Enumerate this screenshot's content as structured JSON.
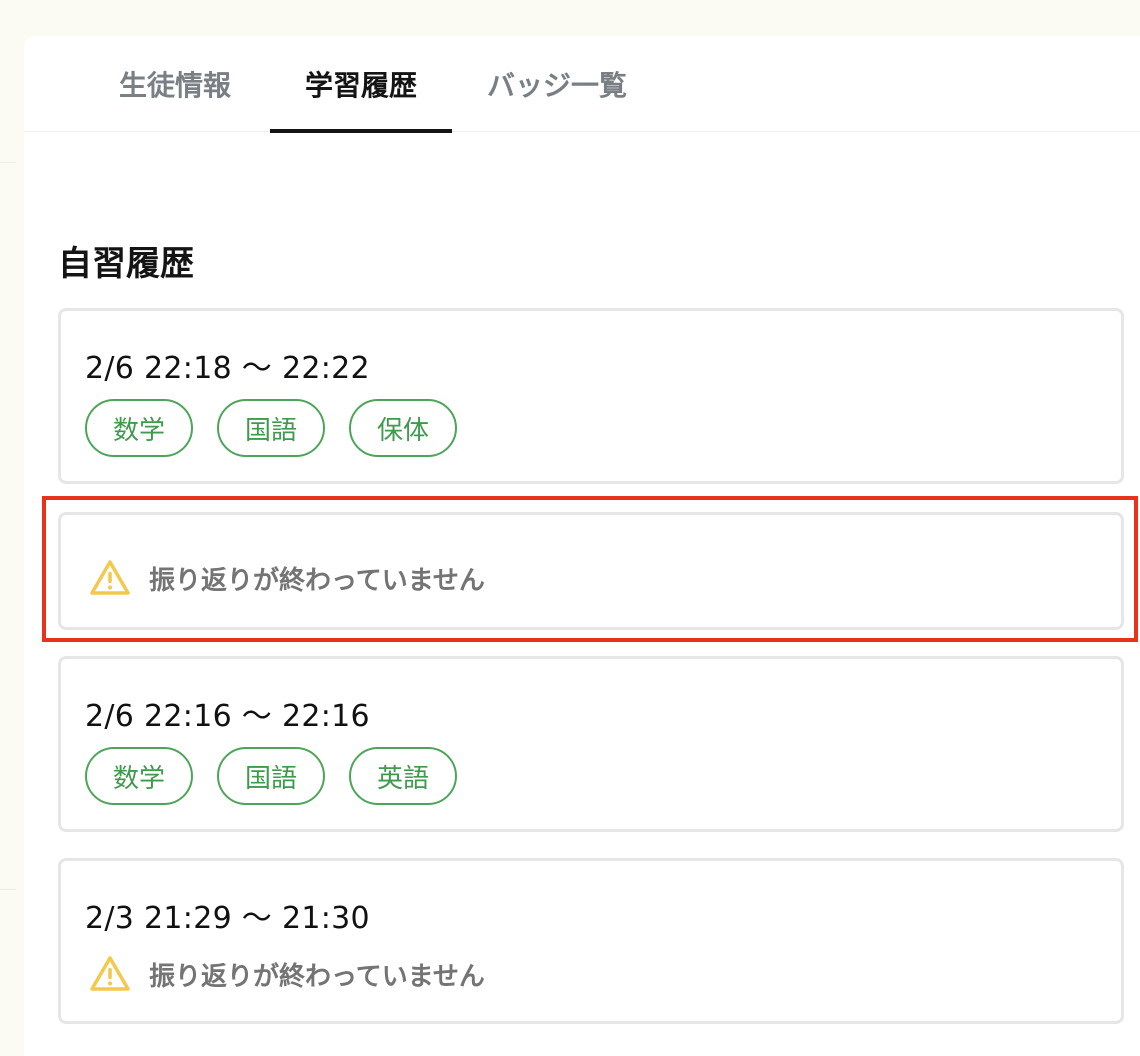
{
  "tabs": [
    {
      "label": "生徒情報",
      "active": false
    },
    {
      "label": "学習履歴",
      "active": true
    },
    {
      "label": "バッジ一覧",
      "active": false
    }
  ],
  "section_title": "自習履歴",
  "sessions": [
    {
      "time": "2/6 22:18 〜 22:22",
      "tags": [
        "数学",
        "国語",
        "保体"
      ]
    },
    {
      "warning": "振り返りが終わっていません"
    },
    {
      "time": "2/6 22:16 〜 22:16",
      "tags": [
        "数学",
        "国語",
        "英語"
      ]
    },
    {
      "time": "2/3 21:29 〜 21:30",
      "warning": "振り返りが終わっていません"
    }
  ],
  "colors": {
    "tag_border": "#4ea45a",
    "tag_text": "#3f9a4d",
    "warning_icon": "#f2c94c",
    "highlight": "#e8331a",
    "active_tab": "#141414"
  },
  "icons": {
    "warning": "warning-triangle-icon"
  }
}
